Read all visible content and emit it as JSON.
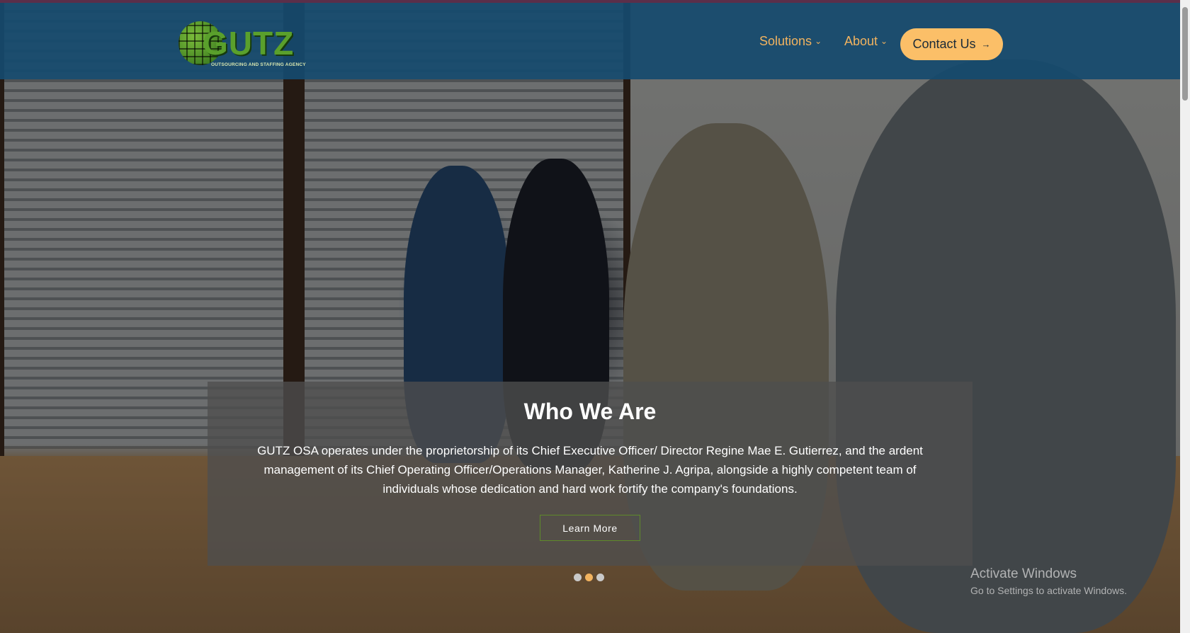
{
  "header": {
    "logo": {
      "word": "GUTZ",
      "tagline": "OUTSOURCING AND STAFFING AGENCY"
    },
    "nav": [
      {
        "label": "Solutions",
        "has_dropdown": true
      },
      {
        "label": "About",
        "has_dropdown": true
      }
    ],
    "contact_button": {
      "label": "Contact Us",
      "icon": "arrow-right-icon"
    }
  },
  "hero": {
    "title": "Who We Are",
    "body": "GUTZ OSA operates under the proprietorship of its Chief Executive Officer/ Director Regine Mae E. Gutierrez, and the ardent management of its Chief Operating Officer/Operations Manager, Katherine J. Agripa, alongside a highly competent team of individuals whose dedication and hard work fortify the company's foundations.",
    "button_label": "Learn More",
    "slides": {
      "count": 3,
      "active_index": 1
    }
  },
  "watermark": {
    "title": "Activate Windows",
    "subtitle": "Go to Settings to activate Windows."
  },
  "colors": {
    "header_bg": "#164a6e",
    "accent": "#f2b35f",
    "contact_bg": "#fbbf68",
    "caption_bg": "#4e4e4e",
    "button_border": "#5e8a2a"
  }
}
